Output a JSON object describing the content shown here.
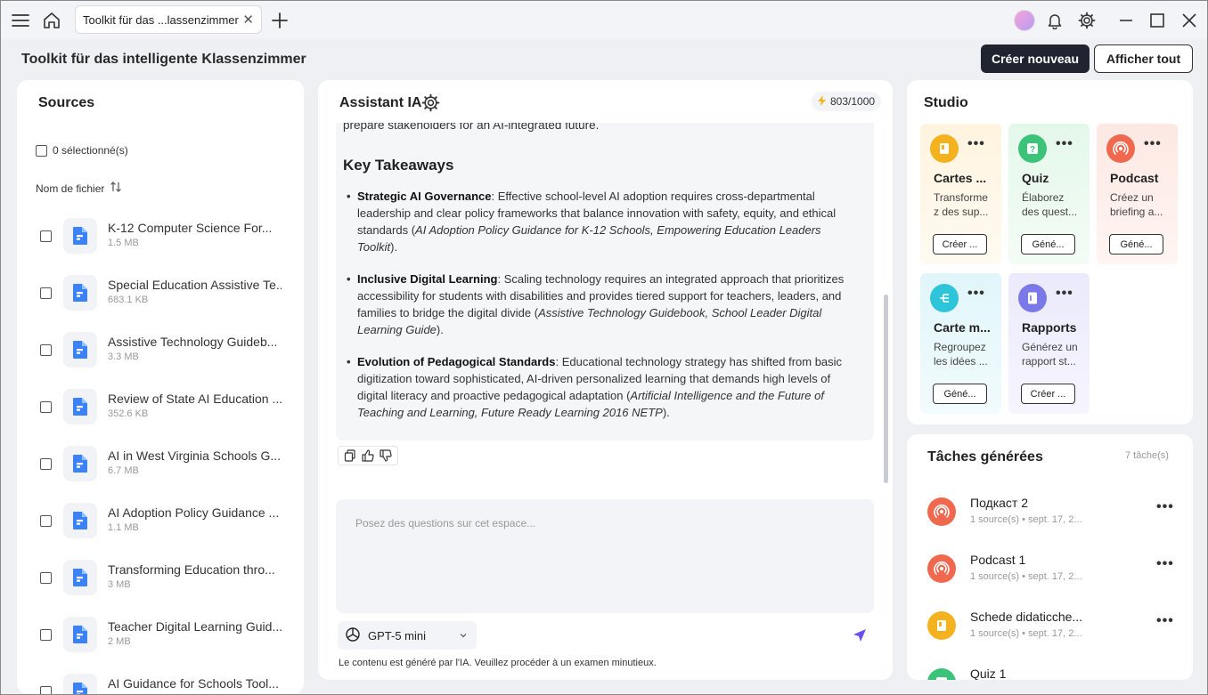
{
  "tab": {
    "title": "Toolkit für das ...lassenzimmer"
  },
  "header": {
    "title": "Toolkit für das intelligente Klassenzimmer",
    "create_label": "Créer nouveau",
    "show_all_label": "Afficher tout"
  },
  "sources": {
    "title": "Sources",
    "selected_label": "0 sélectionné(s)",
    "sort_label": "Nom de fichier",
    "files": [
      {
        "name": "K-12 Computer Science For...",
        "size": "1.5 MB"
      },
      {
        "name": "Special Education Assistive Te...",
        "size": "683.1 KB"
      },
      {
        "name": "Assistive Technology Guideb...",
        "size": "3.3 MB"
      },
      {
        "name": "Review of State AI Education ...",
        "size": "352.6 KB"
      },
      {
        "name": "AI in West Virginia Schools G...",
        "size": "6.7 MB"
      },
      {
        "name": "AI Adoption Policy Guidance ...",
        "size": "1.1 MB"
      },
      {
        "name": "Transforming Education thro...",
        "size": "3 MB"
      },
      {
        "name": "Teacher Digital Learning Guid...",
        "size": "2 MB"
      },
      {
        "name": "AI Guidance for Schools Tool...",
        "size": ""
      }
    ]
  },
  "assistant": {
    "title": "Assistant IA",
    "counter": "803/1000",
    "intro": "prepare stakeholders for an AI-integrated future.",
    "heading": "Key Takeaways",
    "takeaways": [
      {
        "title": "Strategic AI Governance",
        "text": ": Effective school-level AI adoption requires cross-departmental leadership and clear policy frameworks that balance innovation with safety, equity, and ethical standards (",
        "source": "AI Adoption Policy Guidance for K-12 Schools, Empowering Education Leaders Toolkit",
        "end": ")."
      },
      {
        "title": "Inclusive Digital Learning",
        "text": ": Scaling technology requires an integrated approach that prioritizes accessibility for students with disabilities and provides tiered support for teachers, leaders, and families to bridge the digital divide (",
        "source": "Assistive Technology Guidebook, School Leader Digital Learning Guide",
        "end": ")."
      },
      {
        "title": "Evolution of Pedagogical Standards",
        "text": ": Educational technology strategy has shifted from basic digitization toward sophisticated, AI-driven personalized learning that demands high levels of digital literacy and proactive pedagogical adaptation (",
        "source": "Artificial Intelligence and the Future of Teaching and Learning, Future Ready Learning 2016 NETP",
        "end": ")."
      }
    ],
    "input_placeholder": "Posez des questions sur cet espace...",
    "model": "GPT-5 mini",
    "disclaimer": "Le contenu est généré par l'IA. Veuillez procéder à un examen minutieux."
  },
  "studio": {
    "title": "Studio",
    "cards": [
      {
        "title": "Cartes ...",
        "desc": "Transforme z des sup...",
        "button": "Créer ...",
        "icon": "flashcard-icon",
        "color": "#f5b21f"
      },
      {
        "title": "Quiz",
        "desc": "Élaborez des quest...",
        "button": "Géné...",
        "icon": "quiz-icon",
        "color": "#3cc37a"
      },
      {
        "title": "Podcast",
        "desc": "Créez un briefing a...",
        "button": "Géné...",
        "icon": "podcast-icon",
        "color": "#f0684e"
      },
      {
        "title": "Carte m...",
        "desc": "Regroupez les idées ...",
        "button": "Géné...",
        "icon": "mindmap-icon",
        "color": "#2ec4d9"
      },
      {
        "title": "Rapports",
        "desc": "Générez un rapport st...",
        "button": "Créer ...",
        "icon": "report-icon",
        "color": "#7b79e8"
      }
    ]
  },
  "tasks": {
    "title": "Tâches générées",
    "count": "7 tâche(s)",
    "items": [
      {
        "name": "Подкаст 2",
        "meta": "1 source(s) • sept. 17, 2...",
        "icon": "podcast-icon",
        "color": "#f0684e"
      },
      {
        "name": "Podcast 1",
        "meta": "1 source(s) • sept. 17, 2...",
        "icon": "podcast-icon",
        "color": "#f0684e"
      },
      {
        "name": "Schede didaticche...",
        "meta": "1 source(s) • sept. 17, 2...",
        "icon": "flashcard-icon",
        "color": "#f5b21f"
      },
      {
        "name": "Quiz 1",
        "meta": "",
        "icon": "quiz-icon",
        "color": "#3cc37a"
      }
    ]
  }
}
